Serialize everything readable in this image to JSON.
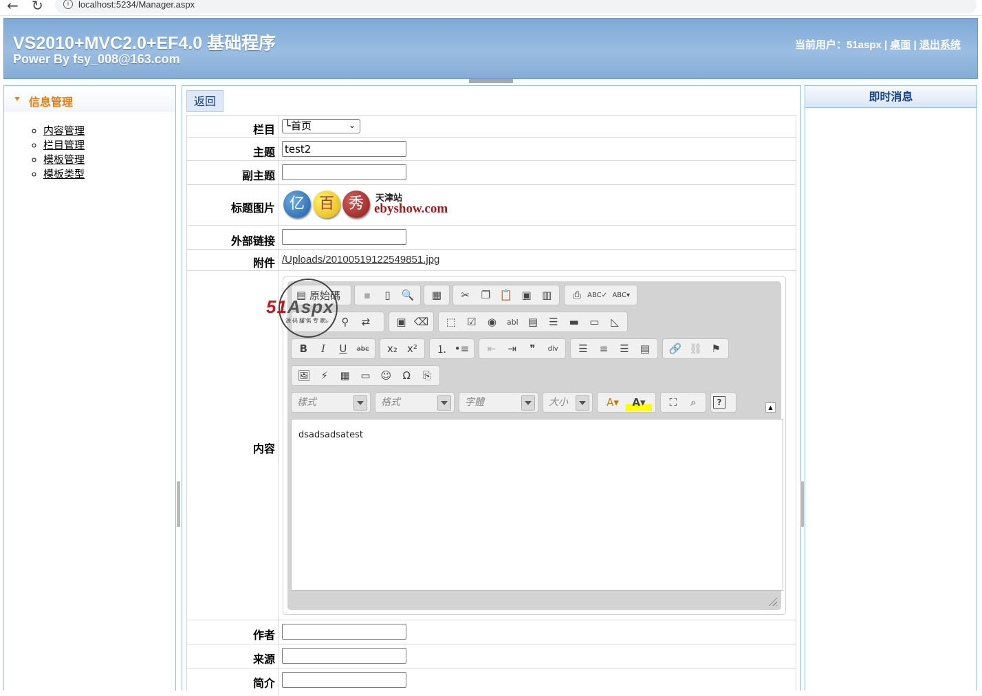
{
  "browser": {
    "url": "localhost:5234/Manager.aspx"
  },
  "header": {
    "title": "VS2010+MVC2.0+EF4.0 基础程序",
    "subtitle": "Power By fsy_008@163.com",
    "user_prefix": "当前用户：51aspx |",
    "desktop_link": "桌面",
    "separator": "|",
    "logout_link": "退出系统"
  },
  "sidebar": {
    "title": "信息管理",
    "items": [
      {
        "label": "内容管理"
      },
      {
        "label": "栏目管理"
      },
      {
        "label": "模板管理"
      },
      {
        "label": "模板类型"
      }
    ]
  },
  "main": {
    "back_button": "返回",
    "fields": {
      "column_label": "栏目",
      "column_value": "└首页",
      "subject_label": "主题",
      "subject_value": "test2",
      "subtitle_label": "副主题",
      "subtitle_value": "",
      "image_label": "标题图片",
      "image_text_city": "天津站",
      "image_text_site": "ebyshow.com",
      "image_chars": [
        "亿",
        "百",
        "秀"
      ],
      "link_label": "外部链接",
      "link_value": "",
      "attach_label": "附件",
      "attach_value": "/Uploads/20100519122549851.jpg",
      "content_label": "内容",
      "author_label": "作者",
      "author_value": "",
      "source_label": "来源",
      "source_value": "",
      "summary_label": "简介",
      "summary_value": ""
    },
    "editor": {
      "source_button": "原始碼",
      "style_combo": "樣式",
      "format_combo": "格式",
      "font_combo": "字體",
      "size_combo": "大小",
      "content": "dsadsadsatest"
    },
    "watermark": {
      "brand_red": "51",
      "brand_grey": "Aspx",
      "tagline": "源码服务专家"
    }
  },
  "right_panel": {
    "title": "即时消息"
  },
  "colors": {
    "header_bg": "#8fb4dc",
    "panel_border": "#99bbe8",
    "sidebar_title": "#e07d10",
    "panel_title": "#15428b"
  }
}
